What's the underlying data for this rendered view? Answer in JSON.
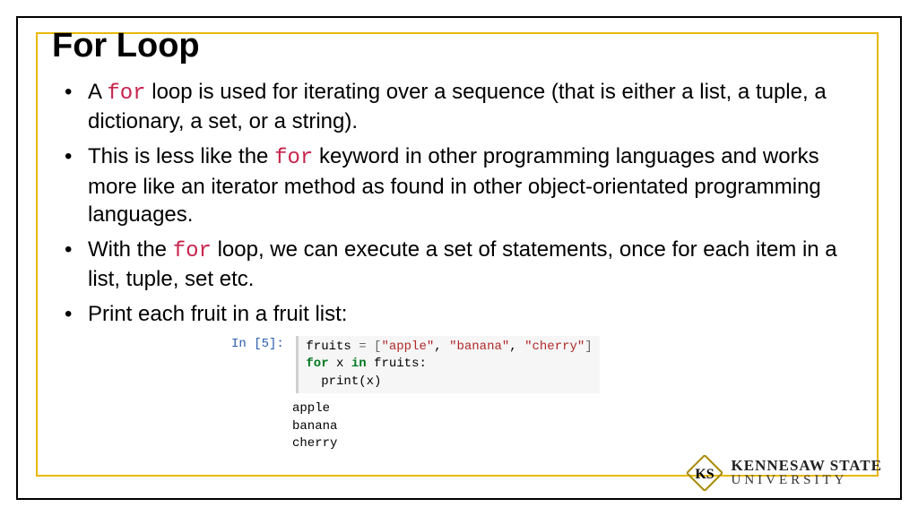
{
  "title": "For Loop",
  "bullets": [
    {
      "pre": "A ",
      "kw": "for",
      "post": " loop is used for iterating over a sequence (that is either a list, a tuple, a dictionary, a set, or a string)."
    },
    {
      "pre": "This is less like the ",
      "kw": "for",
      "post": " keyword in other programming languages and works more like an iterator method as found in other object-orientated programming languages."
    },
    {
      "pre": "With the ",
      "kw": "for",
      "post": " loop, we can execute a set of statements, once for each item in a list, tuple, set etc."
    },
    {
      "pre": "Print each fruit in a fruit list:",
      "kw": "",
      "post": ""
    }
  ],
  "code": {
    "in_label": "In [5]:",
    "line1": {
      "var": "fruits",
      "op": " = [",
      "s1": "\"apple\"",
      "c1": ", ",
      "s2": "\"banana\"",
      "c2": ", ",
      "s3": "\"cherry\"",
      "close": "]"
    },
    "line2": {
      "k1": "for",
      "mid": " x ",
      "k2": "in",
      "post": " fruits:"
    },
    "line3": {
      "indent": "  ",
      "fn": "print",
      "args": "(x)"
    },
    "output": "apple\nbanana\ncherry"
  },
  "logo": {
    "line1": "KENNESAW STATE",
    "line2": "UNIVERSITY"
  }
}
